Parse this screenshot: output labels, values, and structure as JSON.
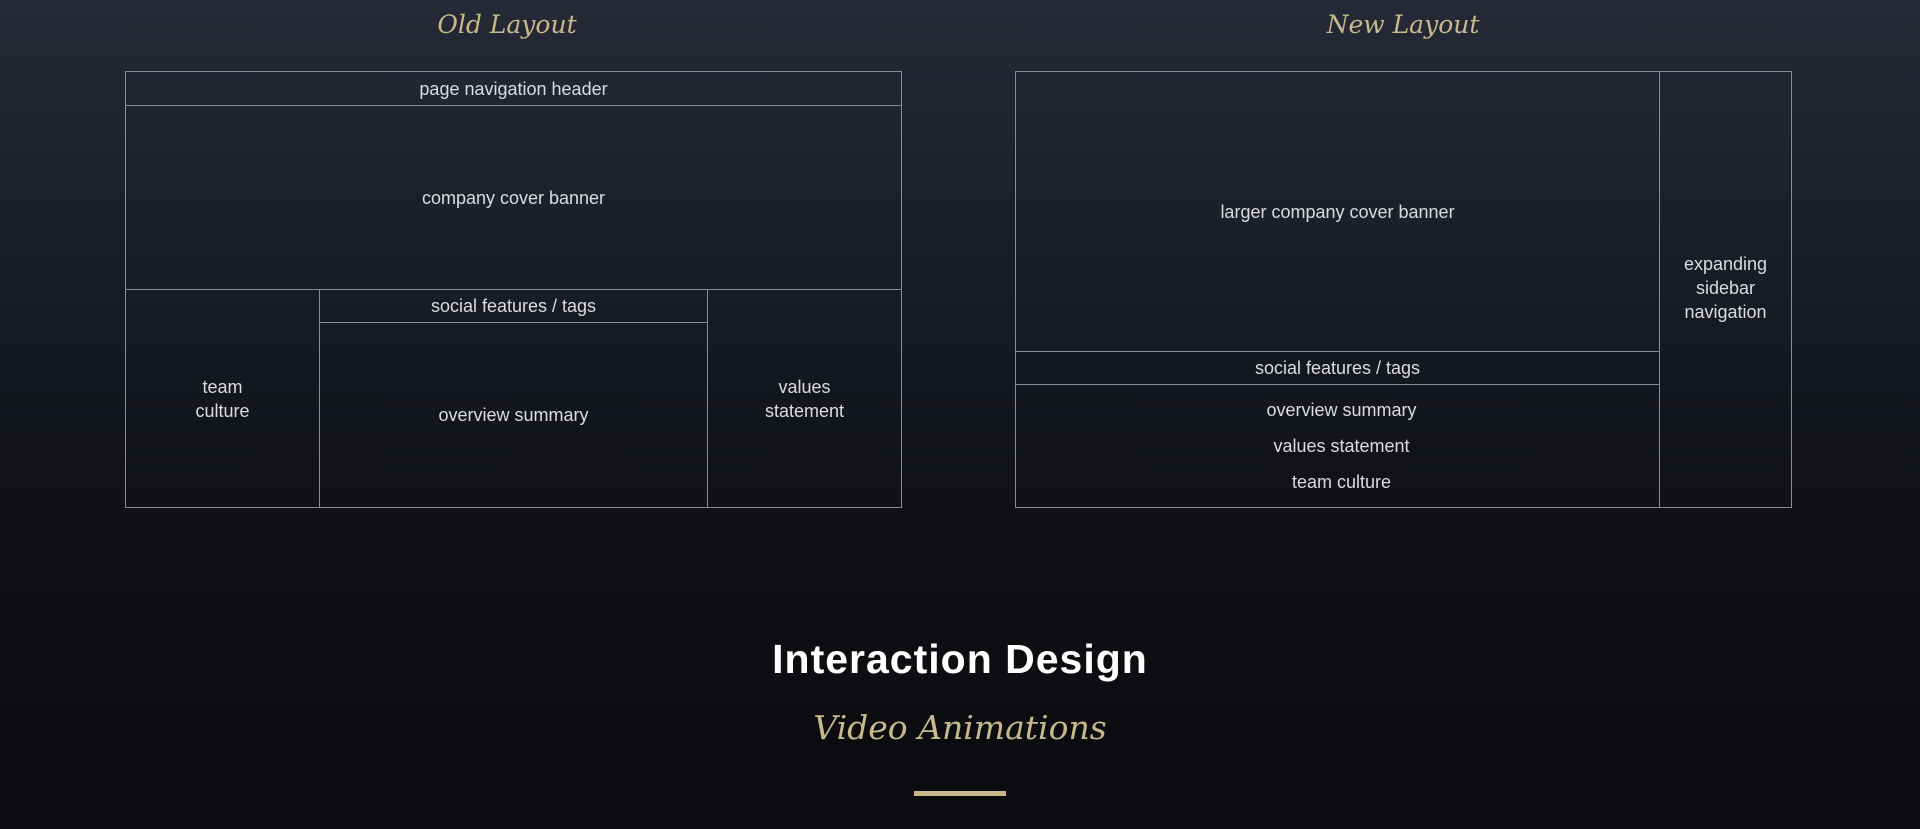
{
  "old_layout": {
    "title": "Old Layout",
    "header": "page navigation header",
    "banner": "company cover banner",
    "team_culture_line1": "team",
    "team_culture_line2": "culture",
    "social": "social features / tags",
    "overview": "overview summary",
    "values_line1": "values",
    "values_line2": "statement"
  },
  "new_layout": {
    "title": "New Layout",
    "banner": "larger company cover banner",
    "sidebar_line1": "expanding",
    "sidebar_line2": "sidebar",
    "sidebar_line3": "navigation",
    "social": "social features / tags",
    "overview": "overview summary",
    "values": "values statement",
    "team_culture": "team culture"
  },
  "section": {
    "title": "Interaction Design",
    "subtitle": "Video Animations"
  },
  "colors": {
    "accent": "#c8b98d",
    "line": "#8a8c95",
    "background_top": "#262a36",
    "background_bottom": "#0a0b0e"
  }
}
